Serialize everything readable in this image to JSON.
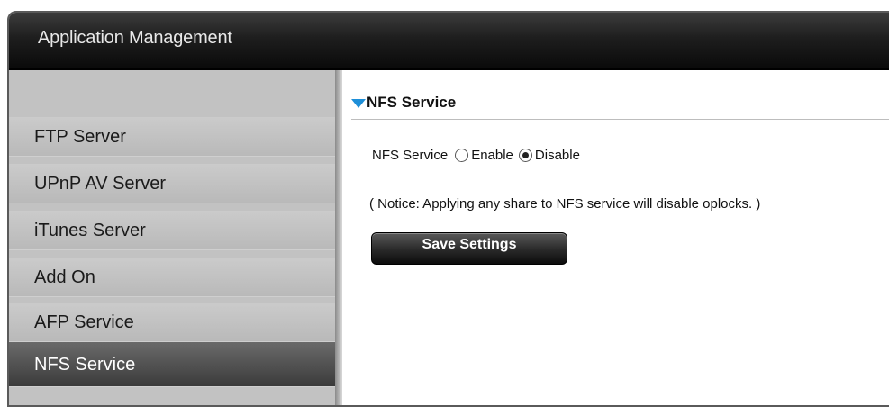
{
  "header": {
    "title": "Application Management"
  },
  "sidebar": {
    "items": [
      {
        "label": "FTP Server"
      },
      {
        "label": "UPnP AV Server"
      },
      {
        "label": "iTunes Server"
      },
      {
        "label": "Add On"
      },
      {
        "label": "AFP Service"
      },
      {
        "label": "NFS Service",
        "active": true
      }
    ]
  },
  "main": {
    "section_title": "NFS Service",
    "nfs_label": "NFS Service",
    "options": [
      {
        "label": "Enable",
        "checked": false
      },
      {
        "label": "Disable",
        "checked": true
      }
    ],
    "notice": "( Notice: Applying any share to NFS service will disable oplocks. )",
    "save_label": "Save Settings"
  },
  "colors": {
    "accent": "#1e8fd8"
  }
}
